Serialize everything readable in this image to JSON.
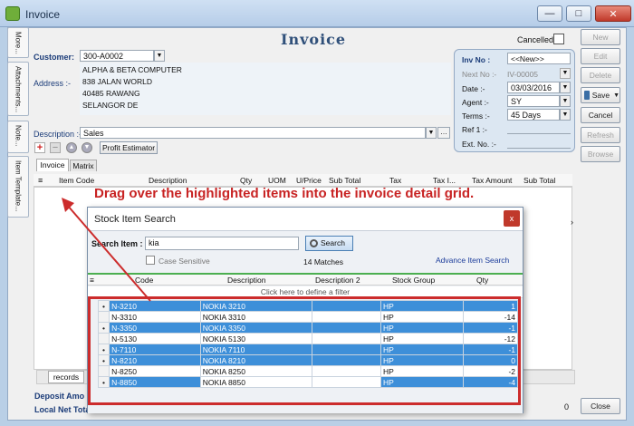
{
  "window": {
    "title": "Invoice"
  },
  "side_tabs": [
    "More...",
    "Attachments...",
    "Note...",
    "Item Template..."
  ],
  "header": {
    "doc_title": "Invoice",
    "cancelled_label": "Cancelled",
    "customer_label": "Customer:",
    "customer_code": "300-A0002",
    "address_label": "Address :-",
    "address_lines": [
      "ALPHA & BETA COMPUTER",
      "838 JALAN WORLD",
      "40485 RAWANG",
      "SELANGOR DE"
    ],
    "description_label": "Description :-",
    "description_value": "Sales"
  },
  "invno_panel": {
    "invno_label": "Inv No :",
    "invno_value": "<<New>>",
    "nextno_label": "Next No :-",
    "nextno_value": "IV-00005",
    "date_label": "Date :-",
    "date_value": "03/03/2016",
    "agent_label": "Agent :-",
    "agent_value": "SY",
    "terms_label": "Terms :-",
    "terms_value": "45 Days",
    "ref1_label": "Ref 1 :-",
    "extno_label": "Ext. No. :-"
  },
  "side_buttons": {
    "new": "New",
    "edit": "Edit",
    "delete": "Delete",
    "save": "Save",
    "cancel": "Cancel",
    "refresh": "Refresh",
    "browse": "Browse",
    "close": "Close"
  },
  "toolbar": {
    "profit_estimator": "Profit Estimator"
  },
  "tabs": [
    "Invoice",
    "Matrix"
  ],
  "grid_columns": [
    "Item Code",
    "Description",
    "Qty",
    "UOM",
    "U/Price",
    "Sub Total",
    "Tax",
    "Tax I...",
    "Tax Amount",
    "Sub Total (Tax)"
  ],
  "callout": "Drag over the highlighted items into the invoice detail grid.",
  "dialog": {
    "title": "Stock Item Search",
    "close_label": "x",
    "search_label": "Search Item :",
    "search_value": "kia",
    "search_button": "Search",
    "case_sensitive": "Case Sensitive",
    "matches": "14 Matches",
    "advance_link": "Advance Item Search",
    "columns": [
      "Code",
      "Description",
      "Description 2",
      "Stock Group",
      "Qty"
    ],
    "filter_hint": "Click here to define a filter",
    "rows": [
      {
        "code": "N-3210",
        "desc": "NOKIA 3210",
        "desc2": "",
        "group": "HP",
        "qty": "1",
        "hl": true,
        "mark": true
      },
      {
        "code": "N-3310",
        "desc": "NOKIA 3310",
        "desc2": "",
        "group": "HP",
        "qty": "-14",
        "hl": false,
        "mark": false
      },
      {
        "code": "N-3350",
        "desc": "NOKIA 3350",
        "desc2": "",
        "group": "HP",
        "qty": "-1",
        "hl": true,
        "mark": true
      },
      {
        "code": "N-5130",
        "desc": "NOKIA 5130",
        "desc2": "",
        "group": "HP",
        "qty": "-12",
        "hl": false,
        "mark": false
      },
      {
        "code": "N-7110",
        "desc": "NOKIA 7110",
        "desc2": "",
        "group": "HP",
        "qty": "-1",
        "hl": true,
        "mark": true
      },
      {
        "code": "N-8210",
        "desc": "NOKIA 8210",
        "desc2": "",
        "group": "HP",
        "qty": "0",
        "hl": true,
        "mark": true
      },
      {
        "code": "N-8250",
        "desc": "NOKIA 8250",
        "desc2": "",
        "group": "HP",
        "qty": "-2",
        "hl": false,
        "mark": false
      },
      {
        "code": "N-8850",
        "desc": "NOKIA 8850",
        "desc2": "",
        "group": "HP",
        "qty": "-4",
        "hl": "partial",
        "mark": true
      }
    ]
  },
  "footer": {
    "records_tab": "records",
    "deposit_label": "Deposit Amo",
    "local_net_label": "Local Net Total:",
    "local_net_value": "0.00",
    "right_value": "0"
  },
  "colors": {
    "highlight": "#3d8fd9",
    "callout": "#c82323",
    "redbox": "#cc2c2c",
    "label_blue": "#1a3b78"
  }
}
